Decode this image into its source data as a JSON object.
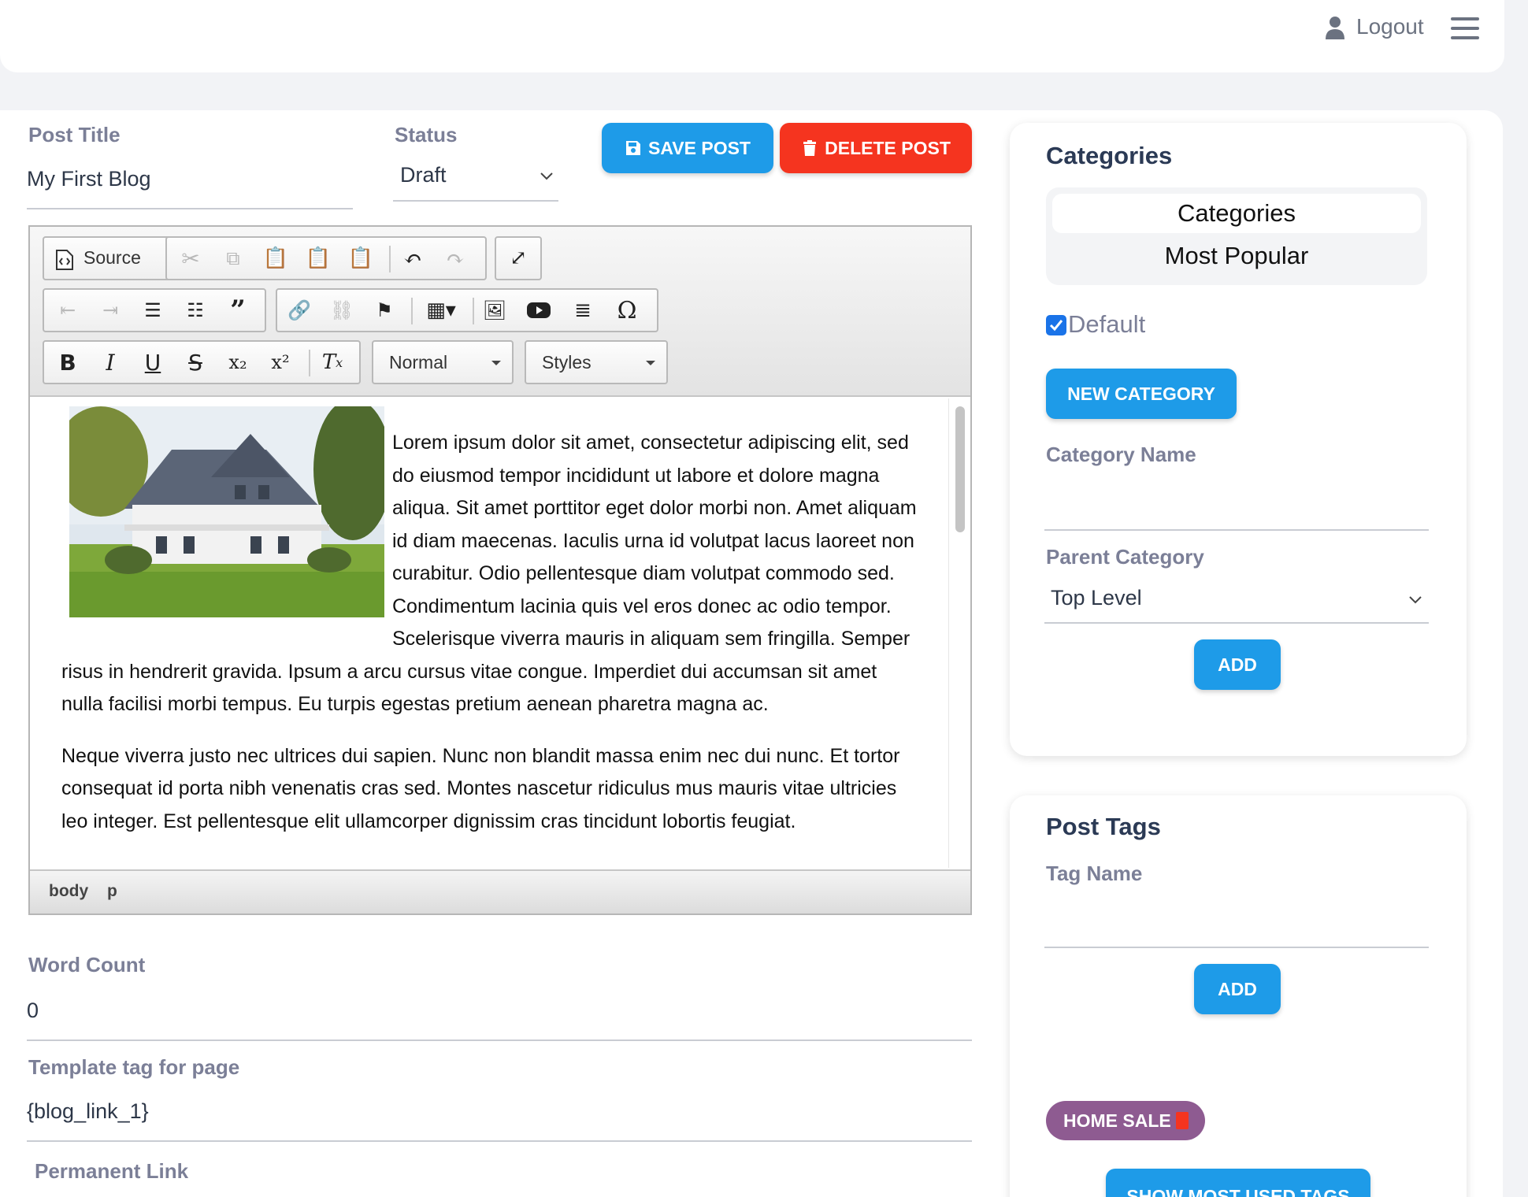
{
  "header": {
    "logout_label": "Logout"
  },
  "post": {
    "title_label": "Post Title",
    "title_value": "My First Blog",
    "status_label": "Status",
    "status_value": "Draft",
    "save_label": "SAVE POST",
    "delete_label": "DELETE POST"
  },
  "editor": {
    "source_label": "Source",
    "format_label": "Normal",
    "styles_label": "Styles",
    "paragraph1": "Lorem ipsum dolor sit amet, consectetur adipiscing elit, sed do eiusmod tempor incididunt ut labore et dolore magna aliqua. Sit amet porttitor eget dolor morbi non. Amet aliquam id diam maecenas. Iaculis urna id volutpat lacus laoreet non curabitur. Odio pellentesque diam volutpat commodo sed. Condimentum lacinia quis vel eros donec ac odio tempor. Scelerisque viverra mauris in aliquam sem fringilla. Semper risus in hendrerit gravida. Ipsum a arcu cursus vitae congue. Imperdiet dui accumsan sit amet nulla facilisi morbi tempus. Eu turpis egestas pretium aenean pharetra magna ac.",
    "paragraph2": "Neque viverra justo nec ultrices dui sapien. Nunc non blandit massa enim nec dui nunc. Et tortor consequat id porta nibh venenatis cras sed. Montes nascetur ridiculus mus mauris vitae ultricies leo integer. Est pellentesque elit ullamcorper dignissim cras tincidunt lobortis feugiat.",
    "path_body": "body",
    "path_p": "p"
  },
  "meta": {
    "word_count_label": "Word Count",
    "word_count_value": "0",
    "template_tag_label": "Template tag for page",
    "template_tag_value": "{blog_link_1}",
    "permanent_link_label": "Permanent Link"
  },
  "categories": {
    "title": "Categories",
    "tab_all": "Categories",
    "tab_popular": "Most Popular",
    "default_label": "Default",
    "default_checked": true,
    "new_button": "NEW CATEGORY",
    "name_label": "Category Name",
    "name_value": "",
    "parent_label": "Parent Category",
    "parent_value": "Top Level",
    "add_button": "ADD"
  },
  "tags": {
    "title": "Post Tags",
    "name_label": "Tag Name",
    "name_value": "",
    "add_button": "ADD",
    "items": [
      "HOME SALE"
    ],
    "most_used_button": "SHOW MOST USED TAGS"
  },
  "colors": {
    "primary": "#1e9be8",
    "danger": "#f5341f",
    "tag": "#8e5b91",
    "label": "#7b7f97"
  }
}
